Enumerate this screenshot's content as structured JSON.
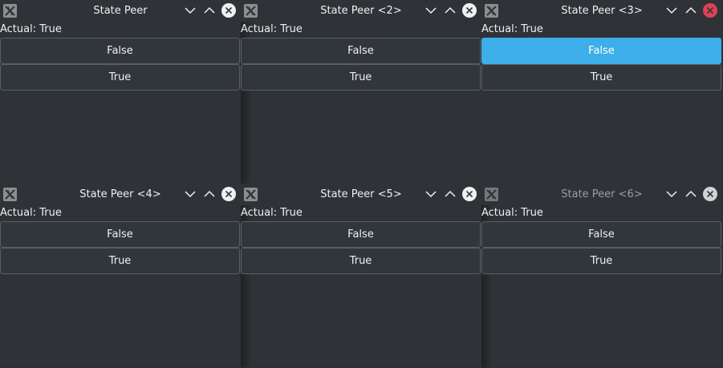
{
  "windows": [
    {
      "title": "State Peer",
      "actual": "Actual: True",
      "false_label": "False",
      "true_label": "True",
      "active": true,
      "close_highlight": false,
      "false_selected": false
    },
    {
      "title": "State Peer <2>",
      "actual": "Actual: True",
      "false_label": "False",
      "true_label": "True",
      "active": true,
      "close_highlight": false,
      "false_selected": false
    },
    {
      "title": "State Peer <3>",
      "actual": "Actual: True",
      "false_label": "False",
      "true_label": "True",
      "active": true,
      "close_highlight": true,
      "false_selected": true
    },
    {
      "title": "State Peer <4>",
      "actual": "Actual: True",
      "false_label": "False",
      "true_label": "True",
      "active": true,
      "close_highlight": false,
      "false_selected": false
    },
    {
      "title": "State Peer <5>",
      "actual": "Actual: True",
      "false_label": "False",
      "true_label": "True",
      "active": true,
      "close_highlight": false,
      "false_selected": false
    },
    {
      "title": "State Peer <6>",
      "actual": "Actual: True",
      "false_label": "False",
      "true_label": "True",
      "active": false,
      "close_highlight": false,
      "false_selected": false
    }
  ],
  "colors": {
    "accent": "#3daee9",
    "close_hover": "#da4453",
    "window_bg": "#2f3337",
    "text": "#eff0f1"
  },
  "icons": {
    "app": "x-app-icon",
    "minimize": "chevron-down-icon",
    "maximize": "chevron-up-icon",
    "close": "close-icon"
  }
}
